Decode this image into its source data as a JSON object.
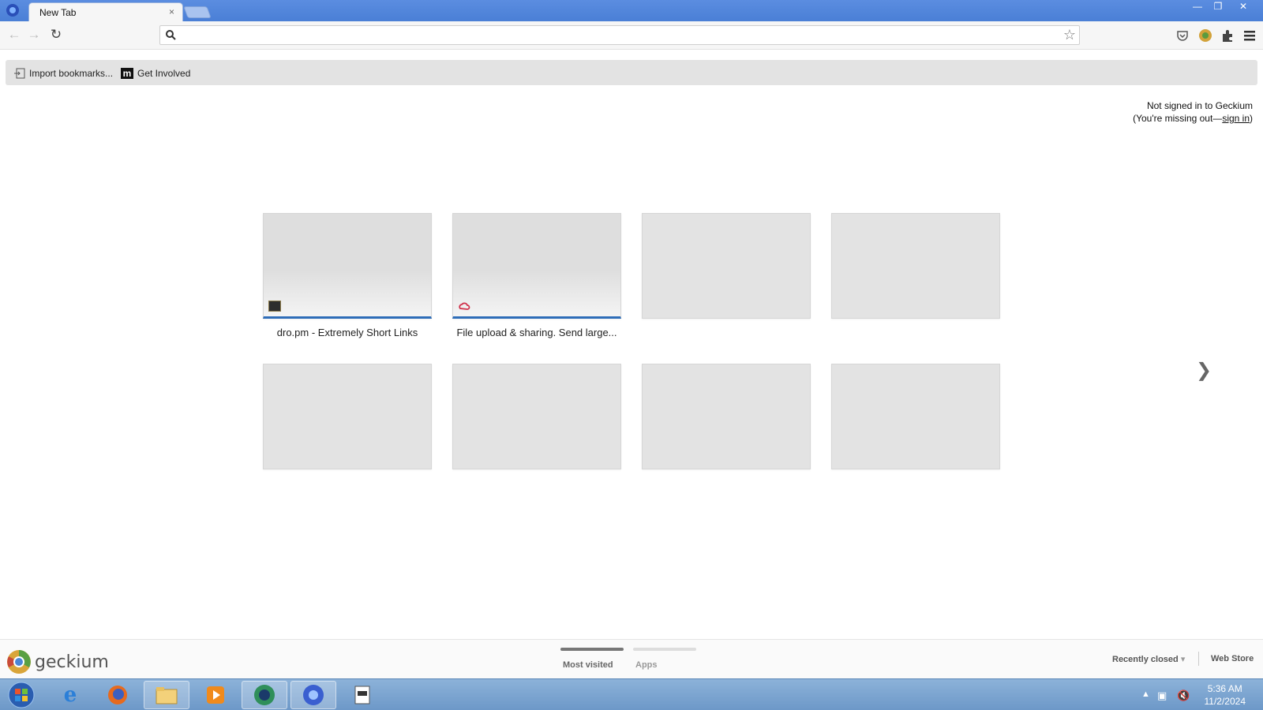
{
  "browser": {
    "tab_title": "New Tab",
    "tab_close": "×",
    "window_controls": [
      "—",
      "❐",
      "✕"
    ]
  },
  "toolbar": {
    "omnibox_value": "",
    "omnibox_placeholder": ""
  },
  "bookmarks": [
    {
      "label": "Import bookmarks...",
      "icon": "import-icon"
    },
    {
      "label": "Get Involved",
      "icon": "m-logo"
    }
  ],
  "signin": {
    "line1": "Not signed in to Geckium",
    "line2_prefix": "(You're missing out—",
    "link": "sign in",
    "line2_suffix": ")"
  },
  "most_visited": [
    {
      "title": "dro.pm - Extremely Short Links",
      "favicon": "dro-favicon"
    },
    {
      "title": "File upload & sharing. Send large...",
      "favicon": "cloud-favicon"
    },
    {
      "title": ""
    },
    {
      "title": ""
    },
    {
      "title": ""
    },
    {
      "title": ""
    },
    {
      "title": ""
    },
    {
      "title": ""
    }
  ],
  "footer": {
    "brand": "geckium",
    "sections": [
      {
        "label": "Most visited",
        "active": true
      },
      {
        "label": "Apps",
        "active": false
      }
    ],
    "recently_closed": "Recently closed",
    "web_store": "Web Store"
  },
  "taskbar": {
    "time": "5:36 AM",
    "date": "11/2/2024"
  },
  "colors": {
    "tabstrip": "#4a7fd6",
    "accent": "#2f6db8",
    "taskbar": "#7aa3cf"
  }
}
